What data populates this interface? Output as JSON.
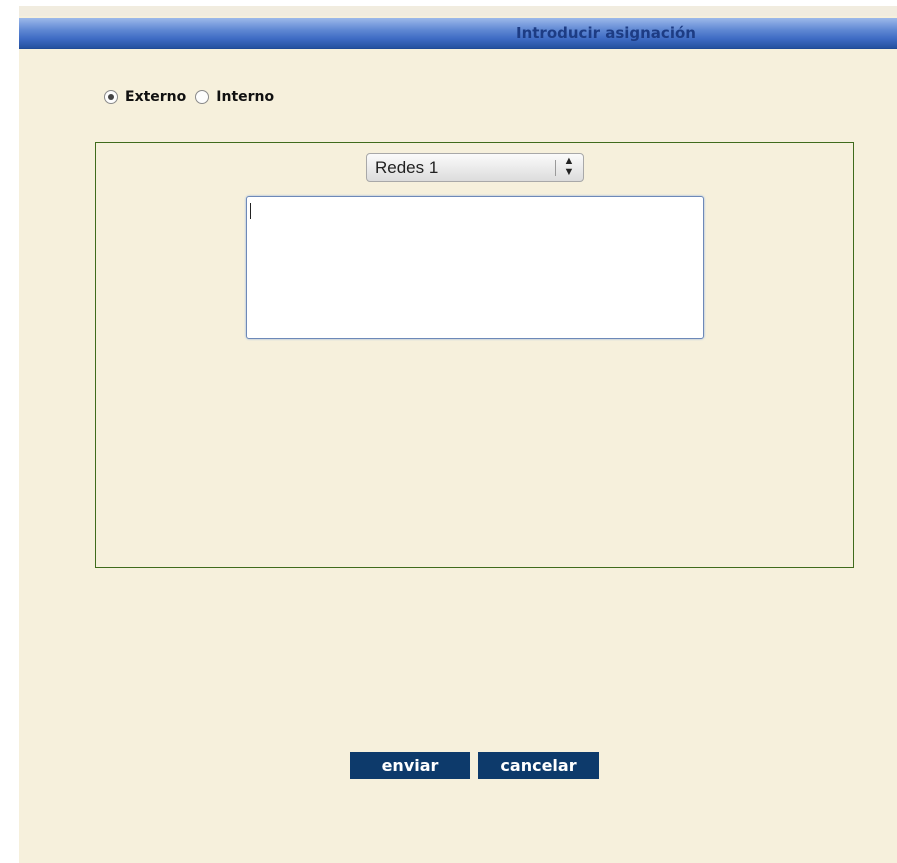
{
  "header": {
    "title": "Introducir asignación"
  },
  "origin": {
    "options": [
      {
        "label": "Externo",
        "selected": true
      },
      {
        "label": "Interno",
        "selected": false
      }
    ]
  },
  "form": {
    "select_value": "Redes 1",
    "textarea_value": ""
  },
  "actions": {
    "send_label": "enviar",
    "cancel_label": "cancelar"
  },
  "colors": {
    "background": "#f6f0dc",
    "titlebar": "#3d6ac3",
    "button": "#0d3a6b",
    "box_border": "#3f6b1c"
  }
}
